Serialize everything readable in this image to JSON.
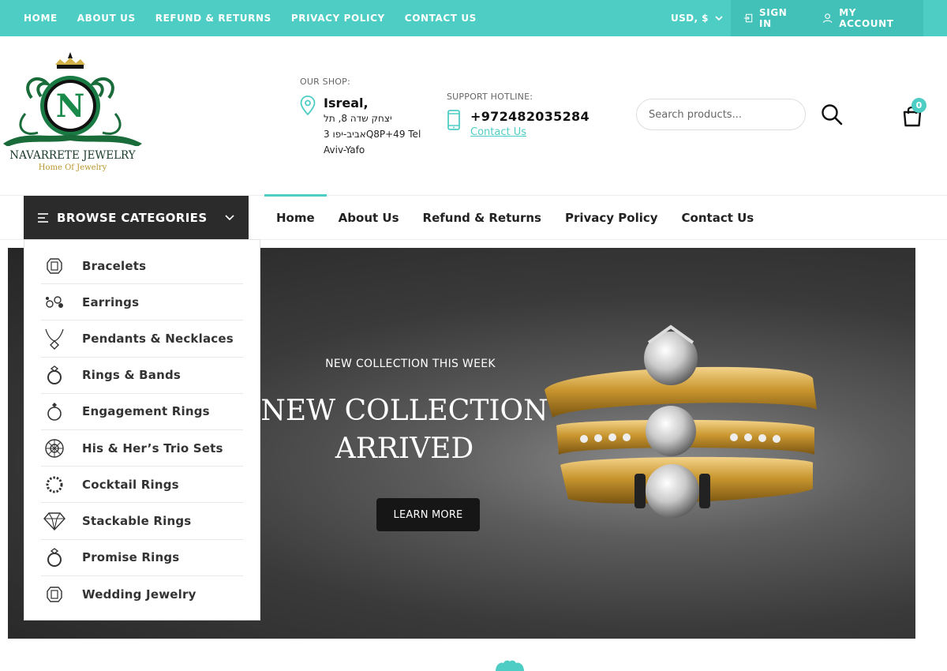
{
  "topbar": {
    "links": [
      "HOME",
      "ABOUT US",
      "REFUND & RETURNS",
      "PRIVACY POLICY",
      "CONTACT US"
    ],
    "currency": "USD, $",
    "sign_in": "SIGN IN",
    "my_account": "MY ACCOUNT",
    "color": "#4ecdc4"
  },
  "logo": {
    "name": "NAVARRETE JEWELRY",
    "tagline": "Home Of Jewelry",
    "letter": "N"
  },
  "shop": {
    "label": "OUR SHOP:",
    "city": "Isreal,",
    "address": "יצחק שדה 8, תל אביב-יפו 3Q8P+49 Tel Aviv-Yafo"
  },
  "support": {
    "label": "SUPPORT HOTLINE:",
    "phone": "+972482035284",
    "link": "Contact Us"
  },
  "search": {
    "placeholder": "Search products..."
  },
  "cart": {
    "count": "0"
  },
  "browse": {
    "label": "BROWSE CATEGORIES"
  },
  "mainnav": [
    "Home",
    "About Us",
    "Refund & Returns",
    "Privacy Policy",
    "Contact Us"
  ],
  "categories": [
    {
      "label": "Bracelets",
      "icon": "bracelet-icon"
    },
    {
      "label": "Earrings",
      "icon": "earrings-icon"
    },
    {
      "label": "Pendants & Necklaces",
      "icon": "necklace-icon"
    },
    {
      "label": "Rings & Bands",
      "icon": "ring-icon"
    },
    {
      "label": "Engagement Rings",
      "icon": "engagement-ring-icon"
    },
    {
      "label": "His & Her’s Trio Sets",
      "icon": "trio-set-icon"
    },
    {
      "label": "Cocktail Rings",
      "icon": "cocktail-ring-icon"
    },
    {
      "label": "Stackable Rings",
      "icon": "diamond-icon"
    },
    {
      "label": "Promise Rings",
      "icon": "ring-icon"
    },
    {
      "label": "Wedding Jewelry",
      "icon": "bracelet-icon"
    }
  ],
  "hero": {
    "subtitle": "NEW COLLECTION THIS WEEK",
    "title_line1": "NEW COLLECTION",
    "title_line2": "ARRIVED",
    "button": "LEARN MORE"
  }
}
